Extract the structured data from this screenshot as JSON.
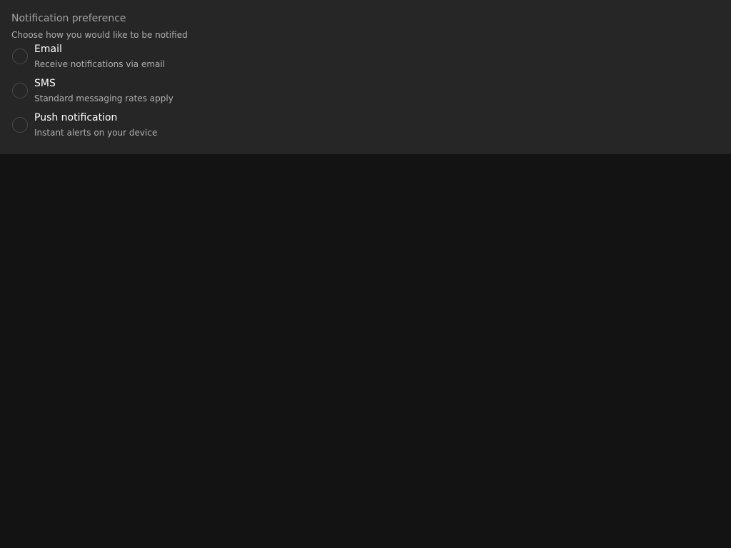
{
  "group": {
    "legend": "Notification preference",
    "description": "Choose how you would like to be notified",
    "options": [
      {
        "label": "Email",
        "hint": "Receive notifications via email",
        "selected": false
      },
      {
        "label": "SMS",
        "hint": "Standard messaging rates apply",
        "selected": false
      },
      {
        "label": "Push notification",
        "hint": "Instant alerts on your device",
        "selected": false
      }
    ]
  },
  "colors": {
    "page_background": "#131313",
    "panel_background": "#262626",
    "legend_text": "#a3a3a3",
    "label_text": "#ffffff",
    "hint_text": "#b0b0b0",
    "radio_border": "#4a4a4a"
  }
}
